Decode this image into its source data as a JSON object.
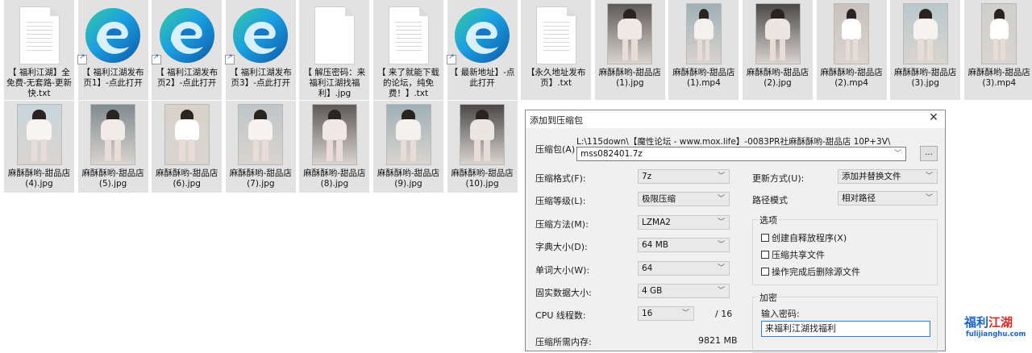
{
  "files_row1": [
    {
      "type": "doc",
      "label": "【 福利江湖】全免费-无套路-更新快.txt"
    },
    {
      "type": "edge",
      "label": "【 福利江湖发布页1】-点此打开"
    },
    {
      "type": "edge",
      "label": "【 福利江湖发布页2】-点此打开"
    },
    {
      "type": "edge",
      "label": "【 福利江湖发布页3】-点此打开"
    },
    {
      "type": "doc-blank",
      "label": "【 解压密码：来福利江湖找福利】.jpg"
    },
    {
      "type": "doc",
      "label": "【 来了就能下载的论坛，纯免费！】.txt"
    },
    {
      "type": "edge",
      "label": "【 最新地址】-点此打开"
    },
    {
      "type": "doc",
      "label": "【永久地址发布页】.txt"
    },
    {
      "type": "photo",
      "label": "麻酥酥哟-甜品店(1).jpg"
    },
    {
      "type": "video",
      "label": "麻酥酥哟-甜品店(1).mp4"
    },
    {
      "type": "photo",
      "label": "麻酥酥哟-甜品店(2).jpg"
    },
    {
      "type": "video",
      "label": "麻酥酥哟-甜品店(2).mp4"
    },
    {
      "type": "photo",
      "label": "麻酥酥哟-甜品店(3).jpg"
    },
    {
      "type": "video",
      "label": "麻酥酥哟-甜品店(3).mp4"
    }
  ],
  "files_row2": [
    {
      "type": "photo",
      "label": "麻酥酥哟-甜品店(4).jpg"
    },
    {
      "type": "photo",
      "label": "麻酥酥哟-甜品店(5).jpg"
    },
    {
      "type": "photo",
      "label": "麻酥酥哟-甜品店(6).jpg"
    },
    {
      "type": "photo",
      "label": "麻酥酥哟-甜品店(7).jpg"
    },
    {
      "type": "photo",
      "label": "麻酥酥哟-甜品店(8).jpg"
    },
    {
      "type": "photo",
      "label": "麻酥酥哟-甜品店(9).jpg"
    },
    {
      "type": "photo",
      "label": "麻酥酥哟-甜品店(10).jpg"
    }
  ],
  "dialog": {
    "title": "添加到压缩包",
    "close_glyph": "✕",
    "archive_label": "压缩包(A)",
    "archive_path": "L:\\115down\\【魔性论坛 - www.mox.life】-0083PR社麻酥酥哟-甜品店 10P+3V\\",
    "archive_name": "mss082401.7z",
    "browse_label": "...",
    "format_label": "压缩格式(F):",
    "format_value": "7z",
    "level_label": "压缩等级(L):",
    "level_value": "极限压缩",
    "method_label": "压缩方法(M):",
    "method_value": "LZMA2",
    "dict_label": "字典大小(D):",
    "dict_value": "64 MB",
    "word_label": "单词大小(W):",
    "word_value": "64",
    "solid_label": "固实数据大小:",
    "solid_value": "4 GB",
    "threads_label": "CPU 线程数:",
    "threads_value": "16",
    "threads_total": "/ 16",
    "memory_label": "压缩所需内存:",
    "memory_value": "9821 MB",
    "update_label": "更新方式(U):",
    "update_value": "添加并替换文件",
    "path_label": "路径模式",
    "path_value": "相对路径",
    "options_title": "选项",
    "opt_sfx": "创建自释放程序(X)",
    "opt_shared": "压缩共享文件",
    "opt_delete": "操作完成后删除源文件",
    "encrypt_title": "加密",
    "password_label": "输入密码:",
    "password_value": "来福利江湖找福利"
  },
  "watermark": {
    "cn_left": "福利",
    "cn_mid": "江湖",
    "en": "fulijianghu.com"
  }
}
